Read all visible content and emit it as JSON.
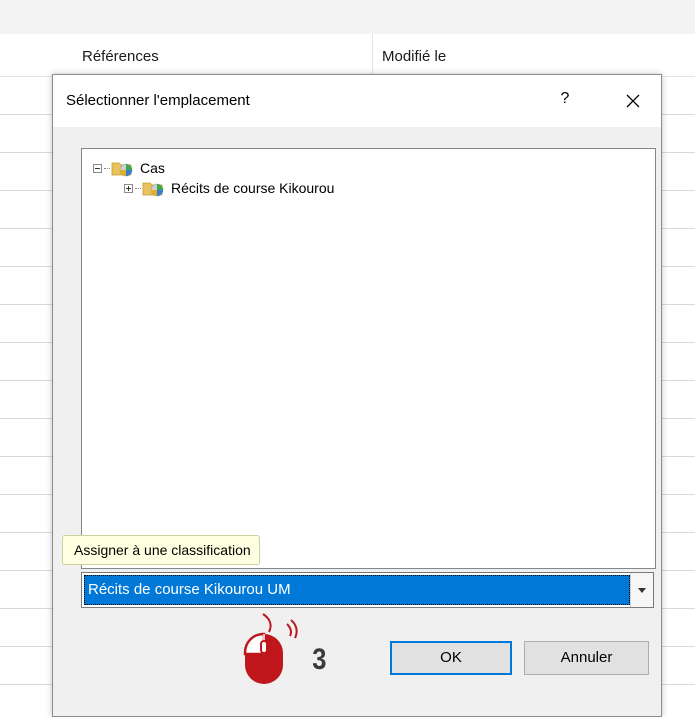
{
  "background": {
    "columns": [
      "Références",
      "Modifié le"
    ]
  },
  "dialog": {
    "title": "Sélectionner l'emplacement",
    "help_label": "?",
    "close_label": "✕",
    "tree": [
      {
        "label": "Cas",
        "expander": "minus",
        "depth": 0
      },
      {
        "label": "Récits de course Kikourou",
        "expander": "plus",
        "depth": 1
      }
    ],
    "tooltip": "Assigner à une classification",
    "combo": {
      "value": "Récits de course Kikourou UM"
    },
    "step_number": "3",
    "buttons": {
      "ok": "OK",
      "cancel": "Annuler"
    }
  },
  "colors": {
    "accent": "#0078d7",
    "mouse": "#c0171c",
    "tooltip_bg": "#ffffe1"
  },
  "icons": [
    "folder-classification-icon",
    "mouse-left-click-icon",
    "dropdown-arrow-icon",
    "close-icon",
    "help-icon"
  ]
}
